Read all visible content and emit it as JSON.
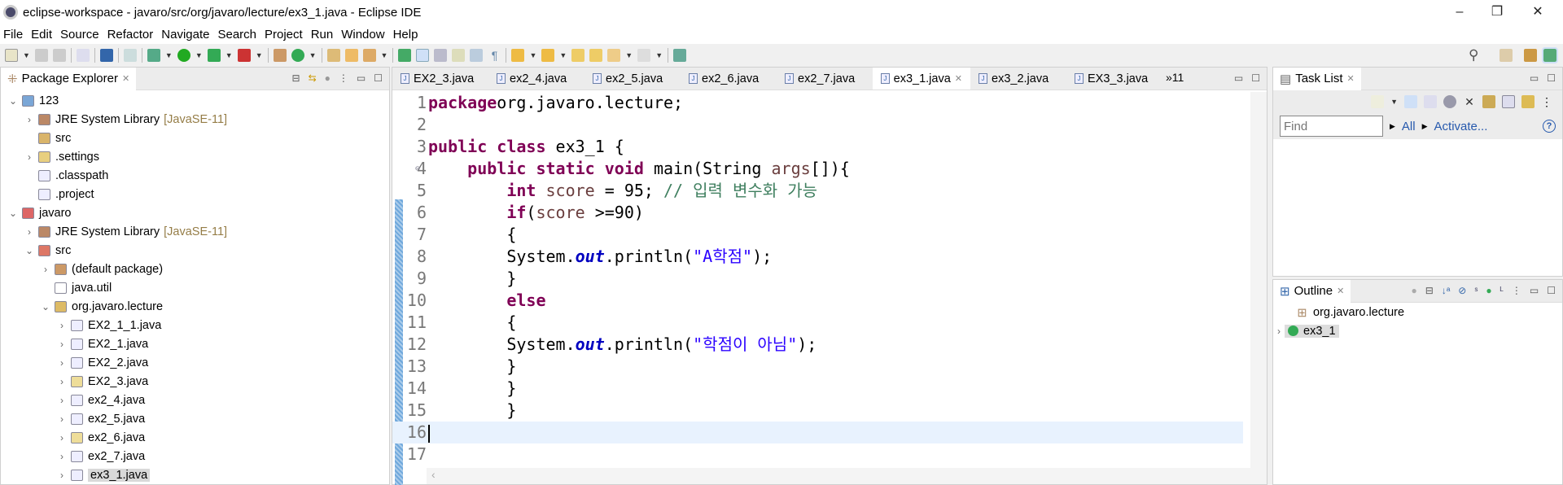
{
  "window": {
    "title": "eclipse-workspace - javaro/src/org/javaro/lecture/ex3_1.java - Eclipse IDE",
    "minimize": "–",
    "maximize": "❐",
    "close": "✕"
  },
  "menu": [
    "File",
    "Edit",
    "Source",
    "Refactor",
    "Navigate",
    "Search",
    "Project",
    "Run",
    "Window",
    "Help"
  ],
  "package_explorer": {
    "title": "Package Explorer",
    "tree": [
      {
        "label": "123",
        "depth": 0,
        "twisty": "v",
        "icon": "project-folder-icon"
      },
      {
        "label": "JRE System Library",
        "decoration": "[JavaSE-11]",
        "depth": 1,
        "twisty": ">",
        "icon": "library-icon"
      },
      {
        "label": "src",
        "depth": 1,
        "twisty": "",
        "icon": "source-folder-icon"
      },
      {
        "label": ".settings",
        "depth": 1,
        "twisty": ">",
        "icon": "folder-icon"
      },
      {
        "label": ".classpath",
        "depth": 1,
        "twisty": "",
        "icon": "xml-file-icon"
      },
      {
        "label": ".project",
        "depth": 1,
        "twisty": "",
        "icon": "xml-file-icon"
      },
      {
        "label": "javaro",
        "depth": 0,
        "twisty": "v",
        "icon": "project-error-icon"
      },
      {
        "label": "JRE System Library",
        "decoration": "[JavaSE-11]",
        "depth": 1,
        "twisty": ">",
        "icon": "library-icon"
      },
      {
        "label": "src",
        "depth": 1,
        "twisty": "v",
        "icon": "source-folder-error-icon"
      },
      {
        "label": "(default package)",
        "depth": 2,
        "twisty": ">",
        "icon": "package-icon"
      },
      {
        "label": "java.util",
        "depth": 2,
        "twisty": "",
        "icon": "empty-package-icon"
      },
      {
        "label": "org.javaro.lecture",
        "depth": 2,
        "twisty": "v",
        "icon": "package-warning-icon"
      },
      {
        "label": "EX2_1_1.java",
        "depth": 3,
        "twisty": ">",
        "icon": "java-file-icon"
      },
      {
        "label": "EX2_1.java",
        "depth": 3,
        "twisty": ">",
        "icon": "java-file-icon"
      },
      {
        "label": "EX2_2.java",
        "depth": 3,
        "twisty": ">",
        "icon": "java-file-icon"
      },
      {
        "label": "EX2_3.java",
        "depth": 3,
        "twisty": ">",
        "icon": "java-file-warning-icon"
      },
      {
        "label": "ex2_4.java",
        "depth": 3,
        "twisty": ">",
        "icon": "java-file-icon"
      },
      {
        "label": "ex2_5.java",
        "depth": 3,
        "twisty": ">",
        "icon": "java-file-icon"
      },
      {
        "label": "ex2_6.java",
        "depth": 3,
        "twisty": ">",
        "icon": "java-file-warning-icon"
      },
      {
        "label": "ex2_7.java",
        "depth": 3,
        "twisty": ">",
        "icon": "java-file-icon"
      },
      {
        "label": "ex3_1.java",
        "depth": 3,
        "twisty": ">",
        "icon": "java-file-icon",
        "selected": true
      }
    ]
  },
  "editor": {
    "tabs": [
      "EX2_3.java",
      "ex2_4.java",
      "ex2_5.java",
      "ex2_6.java",
      "ex2_7.java",
      "ex3_1.java",
      "ex3_2.java",
      "EX3_3.java"
    ],
    "active_tab": 5,
    "overflow": "»11",
    "lines": [
      [
        [
          "kw",
          "package"
        ],
        [
          "",
          "org.javaro.lecture;"
        ]
      ],
      [],
      [
        [
          "kw",
          "public"
        ],
        [
          "",
          " "
        ],
        [
          "kw",
          "class"
        ],
        [
          "",
          " ex3_1 {"
        ]
      ],
      [
        [
          "",
          "    "
        ],
        [
          "kw",
          "public"
        ],
        [
          "",
          " "
        ],
        [
          "kw",
          "static"
        ],
        [
          "",
          " "
        ],
        [
          "kw",
          "void"
        ],
        [
          "",
          " main(String "
        ],
        [
          "var",
          "args"
        ],
        [
          "",
          "[]){"
        ]
      ],
      [
        [
          "",
          "        "
        ],
        [
          "kw",
          "int"
        ],
        [
          "",
          " "
        ],
        [
          "var",
          "score"
        ],
        [
          "",
          " = 95; "
        ],
        [
          "cm",
          "// 입력 변수화 가능"
        ]
      ],
      [
        [
          "",
          "        "
        ],
        [
          "kw",
          "if"
        ],
        [
          "",
          "("
        ],
        [
          "var",
          "score"
        ],
        [
          "",
          " >=90)"
        ]
      ],
      [
        [
          "",
          "        {"
        ]
      ],
      [
        [
          "",
          "        System."
        ],
        [
          "fld",
          "out"
        ],
        [
          "",
          ".println("
        ],
        [
          "str",
          "\"A학점\""
        ],
        [
          "",
          ");"
        ]
      ],
      [
        [
          "",
          "        }"
        ]
      ],
      [
        [
          "",
          "        "
        ],
        [
          "kw",
          "else"
        ]
      ],
      [
        [
          "",
          "        {"
        ]
      ],
      [
        [
          "",
          "        System."
        ],
        [
          "fld",
          "out"
        ],
        [
          "",
          ".println("
        ],
        [
          "str",
          "\"학점이 아님\""
        ],
        [
          "",
          ");"
        ]
      ],
      [
        [
          "",
          "        }"
        ]
      ],
      [
        [
          "",
          "        }"
        ]
      ],
      [
        [
          "",
          "        }"
        ]
      ],
      [],
      []
    ],
    "current_line": 16
  },
  "task_list": {
    "title": "Task List",
    "find_placeholder": "Find",
    "all": "All",
    "activate": "Activate...",
    "help": "?"
  },
  "outline": {
    "title": "Outline",
    "items": [
      {
        "label": "org.javaro.lecture",
        "icon": "package-icon"
      },
      {
        "label": "ex3_1",
        "icon": "class-icon"
      }
    ]
  },
  "colors": {
    "keyword": "#7f0055",
    "string": "#2a00ff",
    "comment": "#3f7f5f",
    "field": "#0000c0",
    "current_line": "#e8f2fe"
  }
}
